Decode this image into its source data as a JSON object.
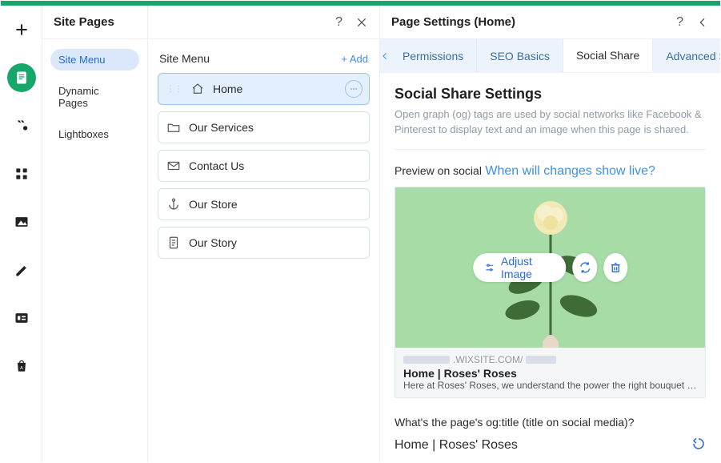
{
  "sitePages": {
    "title": "Site Pages",
    "categories": [
      {
        "label": "Site Menu",
        "selected": true
      },
      {
        "label": "Dynamic Pages",
        "selected": false
      },
      {
        "label": "Lightboxes",
        "selected": false
      }
    ]
  },
  "siteMenu": {
    "heading": "Site Menu",
    "addLabel": "+ Add",
    "pages": [
      {
        "icon": "home-icon",
        "label": "Home",
        "active": true
      },
      {
        "icon": "folder-icon",
        "label": "Our Services",
        "active": false
      },
      {
        "icon": "mail-icon",
        "label": "Contact Us",
        "active": false
      },
      {
        "icon": "anchor-icon",
        "label": "Our Store",
        "active": false
      },
      {
        "icon": "doc-icon",
        "label": "Our Story",
        "active": false
      }
    ]
  },
  "pageSettings": {
    "title": "Page Settings (Home)",
    "tabs": [
      "Permissions",
      "SEO Basics",
      "Social Share",
      "Advanced SEO"
    ],
    "activeTab": "Social Share",
    "section": {
      "title": "Social Share Settings",
      "description": "Open graph (og) tags are used by social networks like Facebook & Pinterest to display text and an image when this page is shared."
    },
    "preview": {
      "label": "Preview on social",
      "liveLink": "When will changes show live?",
      "adjustImageLabel": "Adjust Image",
      "host": ".WIXSITE.COM/",
      "cardTitle": "Home | Roses' Roses",
      "cardDescription": "Here at Roses' Roses, we understand the power the right bouquet has in s…"
    },
    "ogTitle": {
      "label": "What's the page's og:title (title on social media)?",
      "value": "Home | Roses' Roses"
    }
  }
}
